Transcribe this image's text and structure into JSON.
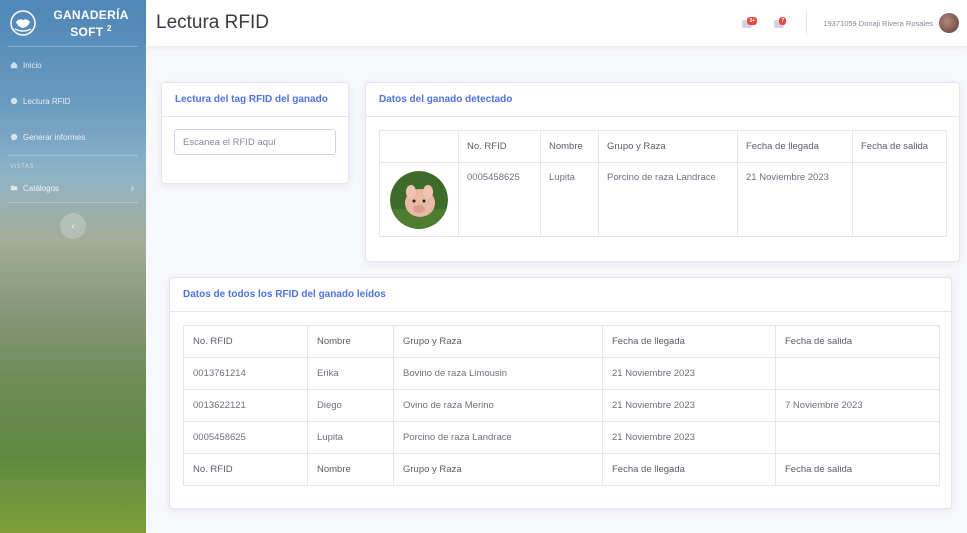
{
  "sidebar": {
    "brand_line1": "GANADERÍA",
    "brand_line2": "SOFT",
    "brand_sup": "2",
    "items": [
      {
        "label": "Inicio",
        "icon": "home-icon"
      },
      {
        "label": "Lectura RFID",
        "icon": "rfid-icon"
      },
      {
        "label": "Generar informes",
        "icon": "report-icon"
      }
    ],
    "heading": "VISTAS",
    "catalogos": {
      "label": "Catálogos",
      "icon": "folder-icon"
    },
    "toggle_glyph": "‹"
  },
  "topbar": {
    "title": "Lectura RFID",
    "alerts_badge": "3+",
    "messages_badge": "7",
    "user_name": "19371059  Donaji Rivera Rosales"
  },
  "rfid_card": {
    "header": "Lectura del tag RFID del ganado",
    "input_placeholder": "Escanea el RFID aquí"
  },
  "detected_card": {
    "header": "Datos del ganado detectado",
    "columns": [
      "",
      "No. RFID",
      "Nombre",
      "Grupo y Raza",
      "Fecha de llegada",
      "Fecha de salida"
    ],
    "row": {
      "rfid": "0005458625",
      "nombre": "Lupita",
      "grupo": "Porcino de raza Landrace",
      "llegada": "21 Noviembre 2023",
      "salida": ""
    }
  },
  "all_card": {
    "header": "Datos de todos los RFID del ganado leídos",
    "columns": [
      "No. RFID",
      "Nombre",
      "Grupo y Raza",
      "Fecha de llegada",
      "Fecha de salida"
    ],
    "rows": [
      [
        "0013761214",
        "Erika",
        "Bovino de raza Limousin",
        "21 Noviembre 2023",
        ""
      ],
      [
        "0013622121",
        "Diego",
        "Ovino de raza Merino",
        "21 Noviembre 2023",
        "7 Noviembre 2023"
      ],
      [
        "0005458625",
        "Lupita",
        "Porcino de raza Landrace",
        "21 Noviembre 2023",
        ""
      ]
    ]
  },
  "colors": {
    "accent": "#4e73df",
    "badge": "#e74a3b"
  }
}
